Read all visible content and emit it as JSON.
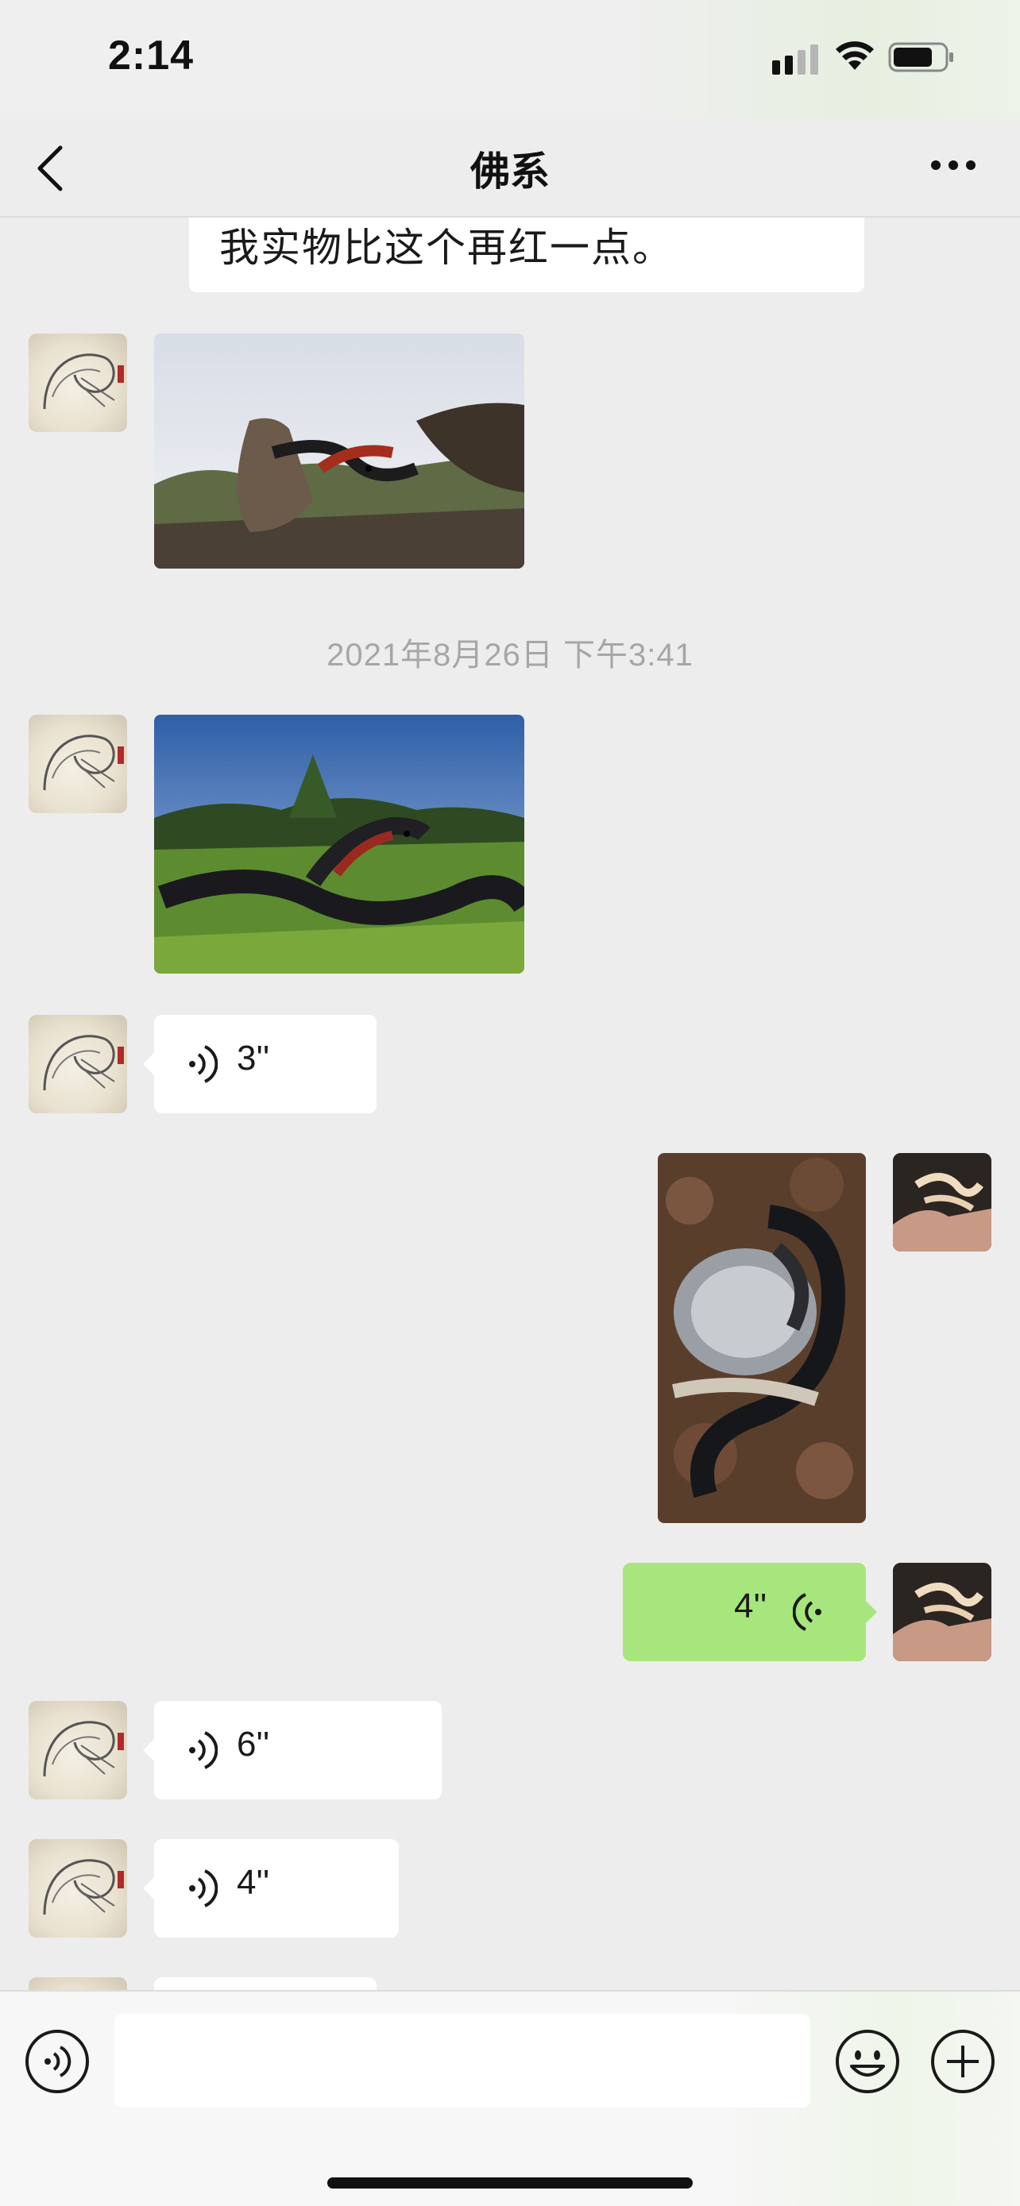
{
  "status_bar": {
    "time": "2:14"
  },
  "nav": {
    "title": "佛系"
  },
  "messages": {
    "partial_text": "我实物比这个再红一点。",
    "timestamp": "2021年8月26日 下午3:41",
    "voice_1_duration": "3''",
    "voice_2_duration": "4''",
    "voice_3_duration": "6''",
    "voice_4_duration": "4''"
  },
  "input": {
    "placeholder": ""
  },
  "icons": {
    "back": "chevron-left-icon",
    "more": "more-dots-icon",
    "voice_input": "voice-input-icon",
    "emoji": "emoji-icon",
    "add": "plus-icon"
  },
  "colors": {
    "own_bubble": "#a7e57d",
    "other_bubble": "#ffffff",
    "chat_background": "#ededed"
  }
}
